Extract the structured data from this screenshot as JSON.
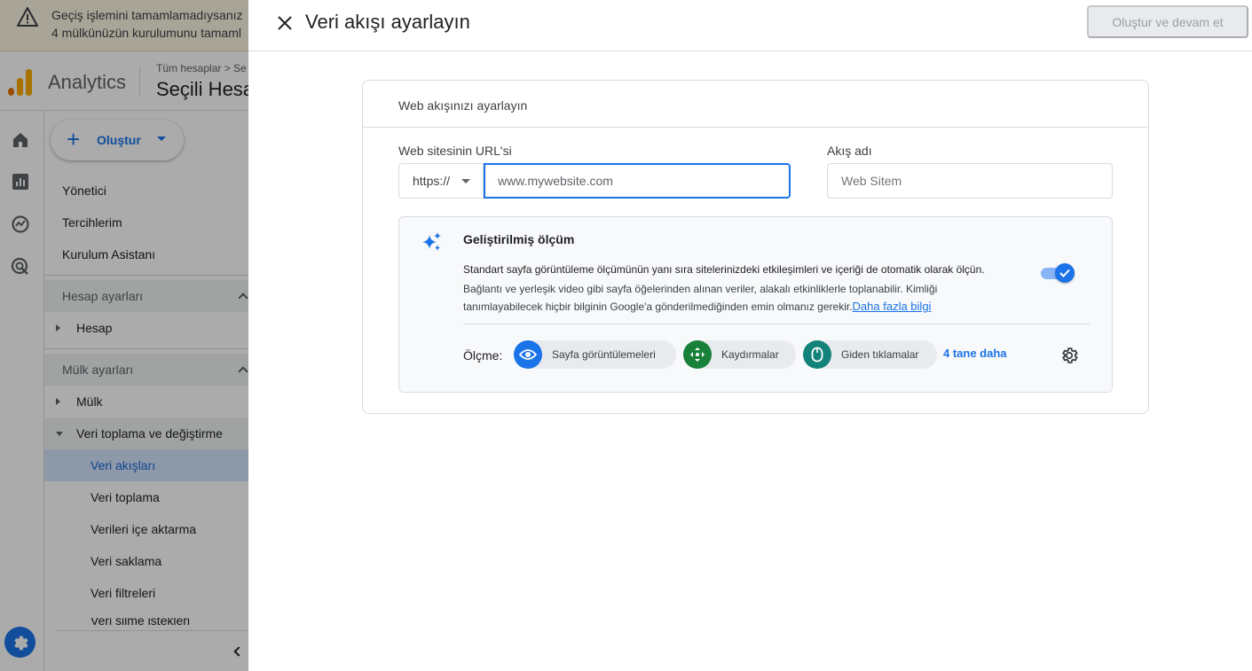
{
  "banner": {
    "line1": "Geçiş işlemini tamamlamadıysanız",
    "line2": "4 mülkünüzün kurulumunu tamaml"
  },
  "header": {
    "app_name": "Analytics",
    "breadcrumb": "Tüm hesaplar > Se",
    "account": "Seçili Hesa"
  },
  "nav": {
    "create_label": "Oluştur",
    "items": {
      "admin": "Yönetici",
      "preferences": "Tercihlerim",
      "setup_assistant": "Kurulum Asistanı",
      "account_settings": "Hesap ayarları",
      "account": "Hesap",
      "property_settings": "Mülk ayarları",
      "property": "Mülk",
      "data_collection_modification": "Veri toplama ve değiştirme",
      "data_streams": "Veri akışları",
      "data_collection": "Veri toplama",
      "data_import": "Verileri içe aktarma",
      "data_retention": "Veri saklama",
      "data_filters": "Veri filtreleri",
      "data_deletion": "Veri silme istekleri"
    }
  },
  "dialog": {
    "title": "Veri akışı ayarlayın",
    "submit_label": "Oluştur ve devam et",
    "card_title": "Web akışınızı ayarlayın",
    "url_label": "Web sitesinin URL'si",
    "protocol": "https://",
    "url_placeholder": "www.mywebsite.com",
    "stream_name_label": "Akış adı",
    "stream_name_placeholder": "Web Sitem",
    "enhanced": {
      "title": "Geliştirilmiş ölçüm",
      "description_main": "Standart sayfa görüntüleme ölçümünün yanı sıra sitelerinizdeki etkileşimleri ve içeriği de otomatik olarak ölçün.",
      "description_sub": "Bağlantı ve yerleşik video gibi sayfa öğelerinden alınan veriler, alakalı etkinliklerle toplanabilir. Kimliği tanımlayabilecek hiçbir bilginin Google'a gönderilmediğinden emin olmanız gerekir.",
      "learn_more": "Daha fazla bilgi",
      "enabled": true,
      "measuring_label": "Ölçme:",
      "chips": [
        {
          "label": "Sayfa görüntülemeleri",
          "icon": "eye-icon",
          "color": "#1a73e8"
        },
        {
          "label": "Kaydırmalar",
          "icon": "scroll-arrows-icon",
          "color": "#188038"
        },
        {
          "label": "Giden tıklamalar",
          "icon": "mouse-icon",
          "color": "#12837a"
        }
      ],
      "more_label": "4 tane daha"
    }
  },
  "colors": {
    "accent": "#1a73e8",
    "warning_bg": "#fdf5e3"
  }
}
